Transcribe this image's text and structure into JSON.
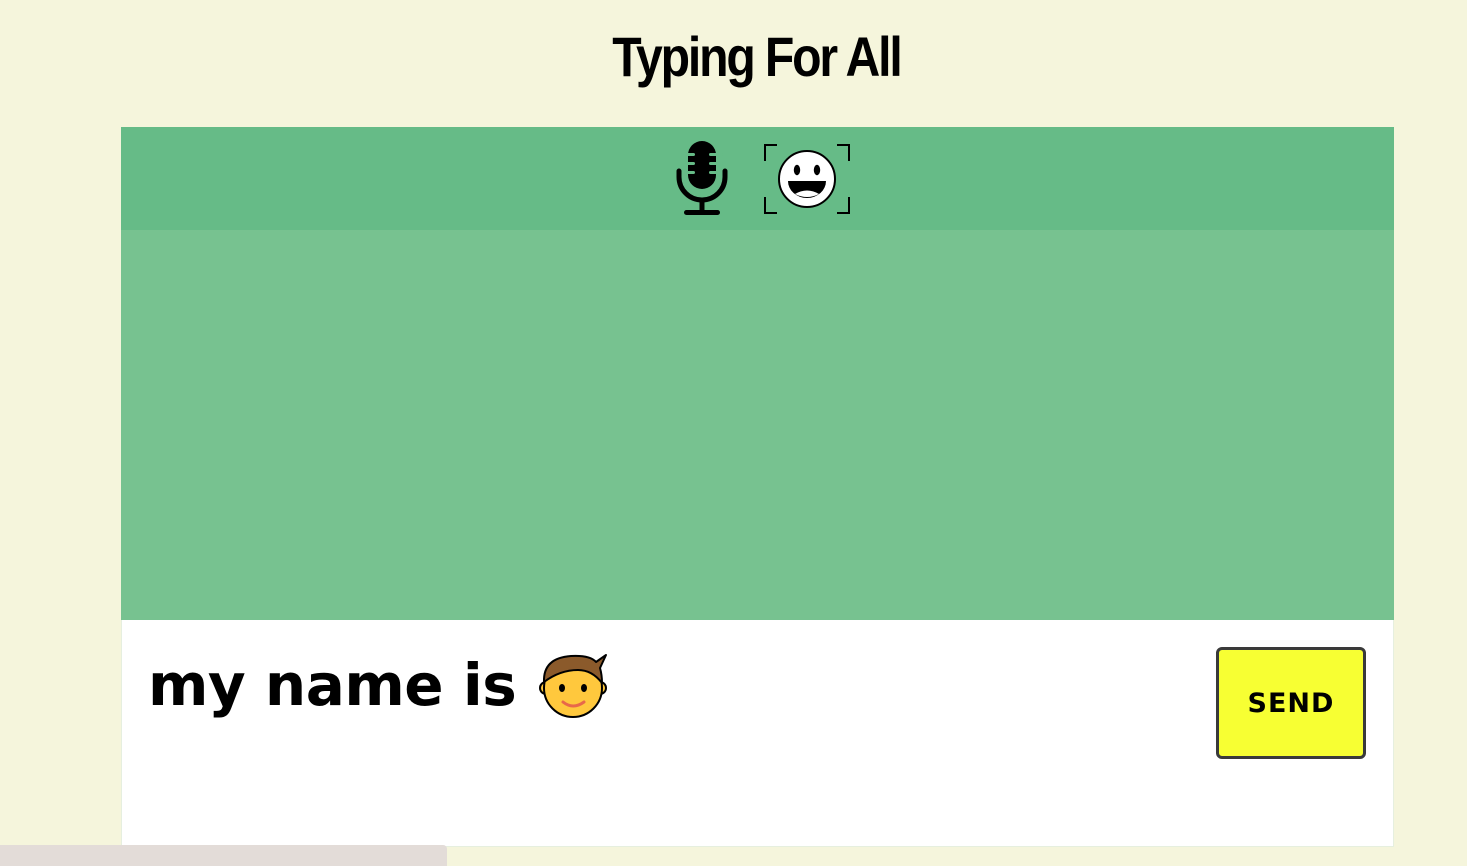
{
  "header": {
    "title": "Typing For All"
  },
  "toolbar": {
    "icons": [
      "microphone-icon",
      "face-scan-icon"
    ]
  },
  "input": {
    "text": "my name is",
    "emoji": "boy-face-emoji"
  },
  "actions": {
    "send_label": "SEND"
  },
  "colors": {
    "background": "#f5f5dc",
    "toolbar": "#66bb87",
    "output_area": "#77c290",
    "input_area": "#ffffff",
    "send_button": "#f7ff33"
  }
}
